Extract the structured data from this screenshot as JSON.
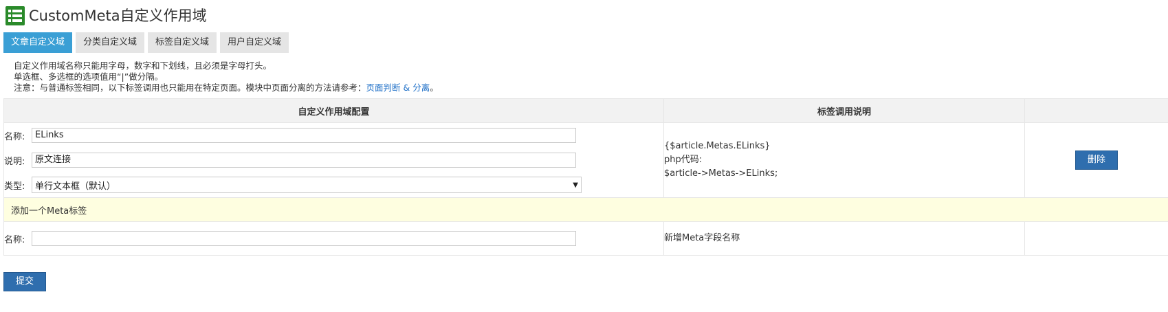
{
  "header": {
    "title": "CustomMeta自定义作用域",
    "icon": "list-icon",
    "icon_color": "#2a8a2a"
  },
  "tabs": [
    {
      "label": "文章自定义域",
      "active": true
    },
    {
      "label": "分类自定义域",
      "active": false
    },
    {
      "label": "标签自定义域",
      "active": false
    },
    {
      "label": "用户自定义域",
      "active": false
    }
  ],
  "notes": {
    "line1": "自定义作用域名称只能用字母，数字和下划线，且必须是字母打头。",
    "line2": "单选框、多选框的选项值用“|”做分隔。",
    "line3_prefix": "注意：与普通标签相同，以下标签调用也只能用在特定页面。模块中页面分离的方法请参考：",
    "line3_link": "页面判断 & 分离",
    "line3_suffix": "。"
  },
  "table": {
    "col_config": "自定义作用域配置",
    "col_tag": "标签调用说明",
    "row": {
      "name_label": "名称:",
      "name_value": "ELinks",
      "desc_label": "说明:",
      "desc_value": "原文连接",
      "type_label": "类型:",
      "type_value": "单行文本框（默认）",
      "tag_line1": "{$article.Metas.ELinks}",
      "tag_line2": "php代码:",
      "tag_line3": "$article->Metas->ELinks;",
      "delete_label": "删除"
    },
    "add_label": "添加一个Meta标签",
    "new_row": {
      "name_label": "名称:",
      "name_value": "",
      "hint": "新增Meta字段名称"
    }
  },
  "submit_label": "提交",
  "colors": {
    "accent": "#3a9fd5",
    "button": "#2f6eae",
    "highlight_row": "#fefee0"
  }
}
